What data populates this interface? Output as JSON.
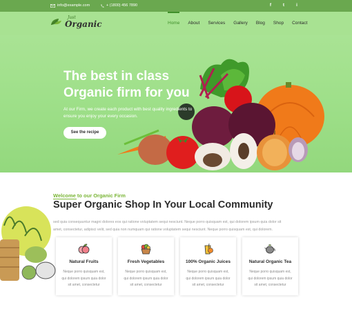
{
  "topbar": {
    "email": "info@example.com",
    "phone": "+ (1800) 456 7890",
    "social": [
      "f",
      "t",
      "i"
    ]
  },
  "header": {
    "logo_small": "Just",
    "logo_big": "Organic",
    "nav": [
      {
        "label": "Home",
        "active": true
      },
      {
        "label": "About"
      },
      {
        "label": "Services"
      },
      {
        "label": "Gallery"
      },
      {
        "label": "Blog"
      },
      {
        "label": "Shop"
      },
      {
        "label": "Contact"
      }
    ]
  },
  "hero": {
    "title_line1": "The best in class",
    "title_line2": "Organic firm for you",
    "text_line1": "At our Firm, we create each product with best quality ingredients to",
    "text_line2": "ensure you enjoy your every occasion.",
    "button": "See the recipe"
  },
  "about": {
    "welcome": "Welcome to our Organic Firm",
    "title": "Super Organic Shop In Your Local Community",
    "line1": "sed quia consequuntur magni dolores eos qui ratione voluptatem sequi nesciunt. Neque porro quisquam est, qui dolorem ipsum quia dolor sit",
    "line2": "amet, consectetur, adipisci velit, sed quia non numquam qui ratione voluptatem sequi nesciunt. Neque porro quisquam est, qui dolorem."
  },
  "cards": [
    {
      "title": "Natural Fruits",
      "icon": "fruit-icon",
      "l1": "Neque porro quisquam est,",
      "l2": "qui dolorem ipsum quia dolor",
      "l3": "sit amet, consectetur"
    },
    {
      "title": "Fresh Vegetables",
      "icon": "vegetable-basket-icon",
      "l1": "Neque porro quisquam est,",
      "l2": "qui dolorem ipsum quia dolor",
      "l3": "sit amet, consectetur"
    },
    {
      "title": "100% Organic Juices",
      "icon": "juice-glass-icon",
      "l1": "Neque porro quisquam est,",
      "l2": "qui dolorem ipsum quia dolor",
      "l3": "sit amet, consectetur"
    },
    {
      "title": "Natural Organic Tea",
      "icon": "teapot-icon",
      "l1": "Neque porro quisquam est,",
      "l2": "qui dolorem ipsum quia dolor",
      "l3": "sit amet, consectetur"
    }
  ],
  "colors": {
    "topbar": "#6aa84f",
    "header": "#a8e292",
    "hero": "#9fe08a",
    "accent": "#7ab536",
    "nav_active": "#3f8f2a"
  }
}
